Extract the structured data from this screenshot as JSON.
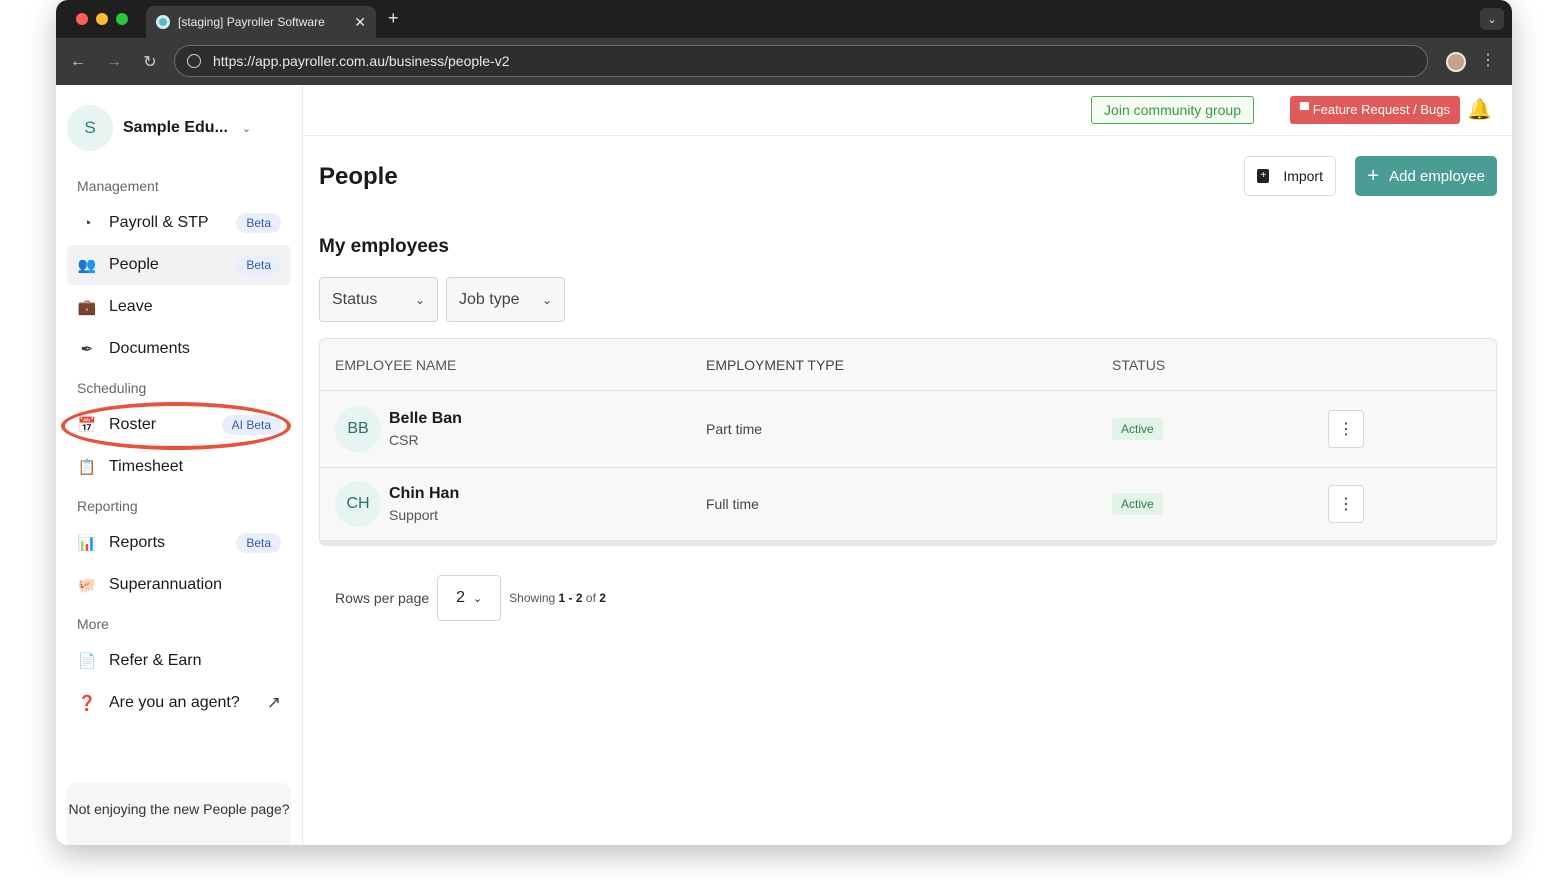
{
  "browser": {
    "tab_title": "[staging] Payroller Software",
    "url": "https://app.payroller.com.au/business/people-v2"
  },
  "org": {
    "initial": "S",
    "name": "Sample Edu..."
  },
  "sidebar": {
    "management_label": "Management",
    "scheduling_label": "Scheduling",
    "reporting_label": "Reporting",
    "more_label": "More",
    "items": {
      "payroll": {
        "label": "Payroll & STP",
        "badge": "Beta"
      },
      "people": {
        "label": "People",
        "badge": "Beta"
      },
      "leave": {
        "label": "Leave"
      },
      "documents": {
        "label": "Documents"
      },
      "roster": {
        "label": "Roster",
        "badge": "AI Beta"
      },
      "timesheet": {
        "label": "Timesheet"
      },
      "reports": {
        "label": "Reports",
        "badge": "Beta"
      },
      "superannuation": {
        "label": "Superannuation"
      },
      "refer": {
        "label": "Refer & Earn"
      },
      "agent": {
        "label": "Are you an agent?"
      }
    },
    "feedback": "Not enjoying the new People page?"
  },
  "topbar": {
    "community_button": "Join community group",
    "feature_button": "Feature Request / Bugs"
  },
  "page": {
    "title": "People",
    "import_button": "Import",
    "add_button": "Add employee",
    "section_title": "My employees"
  },
  "filters": {
    "status": "Status",
    "job_type": "Job type"
  },
  "table": {
    "headers": [
      "EMPLOYEE NAME",
      "EMPLOYMENT TYPE",
      "STATUS"
    ],
    "rows": [
      {
        "initials": "BB",
        "name": "Belle Ban",
        "role": "CSR",
        "type": "Part time",
        "status": "Active"
      },
      {
        "initials": "CH",
        "name": "Chin Han",
        "role": "Support",
        "type": "Full time",
        "status": "Active"
      }
    ]
  },
  "pagination": {
    "rows_label": "Rows per page",
    "rows_value": "2",
    "showing_prefix": "Showing",
    "range": "1 - 2",
    "of": "of",
    "total": "2"
  },
  "colors": {
    "accent": "#4a9c95",
    "highlight": "#e8513a",
    "feature": "#e05a5a",
    "community": "#4caf50"
  }
}
